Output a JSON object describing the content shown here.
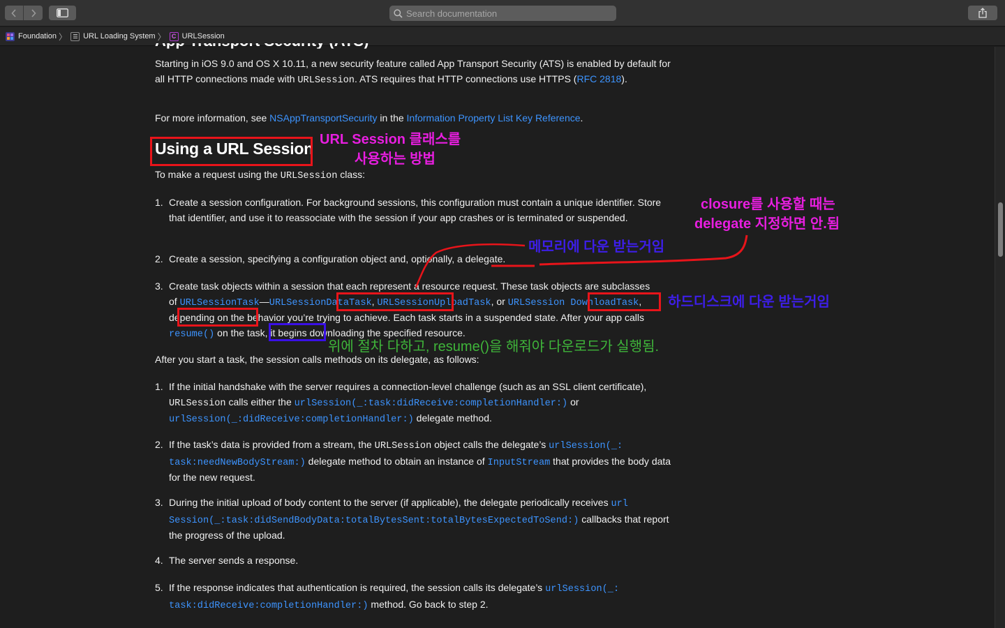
{
  "toolbar": {
    "back_icon": "chevron-left-icon",
    "forward_icon": "chevron-right-icon",
    "sidebar_icon": "sidebar-toggle-icon",
    "search_placeholder": "Search documentation",
    "share_icon": "share-icon"
  },
  "breadcrumb": {
    "items": [
      "Foundation",
      "URL Loading System",
      "URLSession"
    ]
  },
  "content": {
    "truncated_heading": "App Transport Security (ATS)",
    "ats_para_1": "Starting in iOS 9.0 and OS X 10.11, a new security feature called App Transport Security (ATS) is enabled by default for all HTTP connections made with ",
    "ats_code": "URLSession",
    "ats_para_2": ". ATS requires that HTTP connections use HTTPS (",
    "ats_link": "RFC 2818",
    "ats_para_3": ").",
    "more_info_1": "For more information, see ",
    "more_info_link1": "NSAppTransportSecurity",
    "more_info_2": " in the ",
    "more_info_link2": "Information Property List Key Reference",
    "more_info_3": ".",
    "heading": "Using a URL Session",
    "intro_1": "To make a request using the ",
    "intro_code": "URLSession",
    "intro_2": " class:",
    "steps": [
      {
        "num": "1.",
        "text": "Create a session configuration. For background sessions, this configuration must contain a unique identifier. Store that identifier, and use it to reassociate with the session if your app crashes or is terminated or suspended."
      },
      {
        "num": "2.",
        "text": "Create a session, specifying a configuration object and, optionally, a delegate."
      },
      {
        "num": "3.",
        "t1": "Create task objects within a session that each represent a resource request. These task objects are subclasses of ",
        "c1": "URLSessionTask",
        "t2": "—",
        "c2": "URLSessionDataTask",
        "t3": ", ",
        "c3": "URLSessionUploadTask",
        "t4": ", or ",
        "c4": "URLSession DownloadTask",
        "t5": ", depending on the behavior you’re trying to achieve. Each task starts in a suspended state. After your app calls ",
        "c5": "resume()",
        "t6": " on the task, it begins downloading the specified resource."
      }
    ],
    "after_start": "After you start a task, the session calls methods on its delegate, as follows:",
    "events": [
      {
        "num": "1.",
        "t1": "If the initial handshake with the server requires a connection-level challenge (such as an SSL client certificate), ",
        "c1": "URLSession",
        "t2": " calls either the ",
        "l1": "urlSession(_:task:didReceive:completionHandler:)",
        "t3": " or ",
        "l2": "urlSession(_:didReceive:completionHandler:)",
        "t4": " delegate method."
      },
      {
        "num": "2.",
        "t1": "If the task’s data is provided from a stream, the ",
        "c1": "URLSession",
        "t2": " object calls the delegate’s ",
        "l1": "urlSession(_: task:needNewBodyStream:)",
        "t3": " delegate method to obtain an instance of ",
        "l2": "InputStream",
        "t4": " that provides the body data for the new request."
      },
      {
        "num": "3.",
        "t1": "During the initial upload of body content to the server (if applicable), the delegate periodically receives ",
        "l1": "url Session(_:task:didSendBodyData:totalBytesSent:totalBytesExpectedToSend:)",
        "t2": " callbacks that report the progress of the upload."
      },
      {
        "num": "4.",
        "t1": "The server sends a response."
      },
      {
        "num": "5.",
        "t1": "If the response indicates that authentication is required, the session calls its delegate’s ",
        "l1": "urlSession(_: task:didReceive:completionHandler:)",
        "t2": " method. Go back to step 2."
      }
    ]
  },
  "annotations": {
    "heading_note_1": "URL Session 클래스를",
    "heading_note_2": "사용하는 방법",
    "closure_note_1": "closure를 사용할 때는",
    "closure_note_2": "delegate 지정하면 안.됨",
    "memory_note": "메모리에 다운 받는거임",
    "disk_note": "하드디스크에 다운 받는거임",
    "resume_note": "위에 절차 다하고, resume()을 해줘야 다운로드가 실행됨.",
    "colors": {
      "red": "#e8141a",
      "blue": "#3a10e6",
      "magenta": "#e81ee0",
      "green": "#3fb53a"
    }
  }
}
